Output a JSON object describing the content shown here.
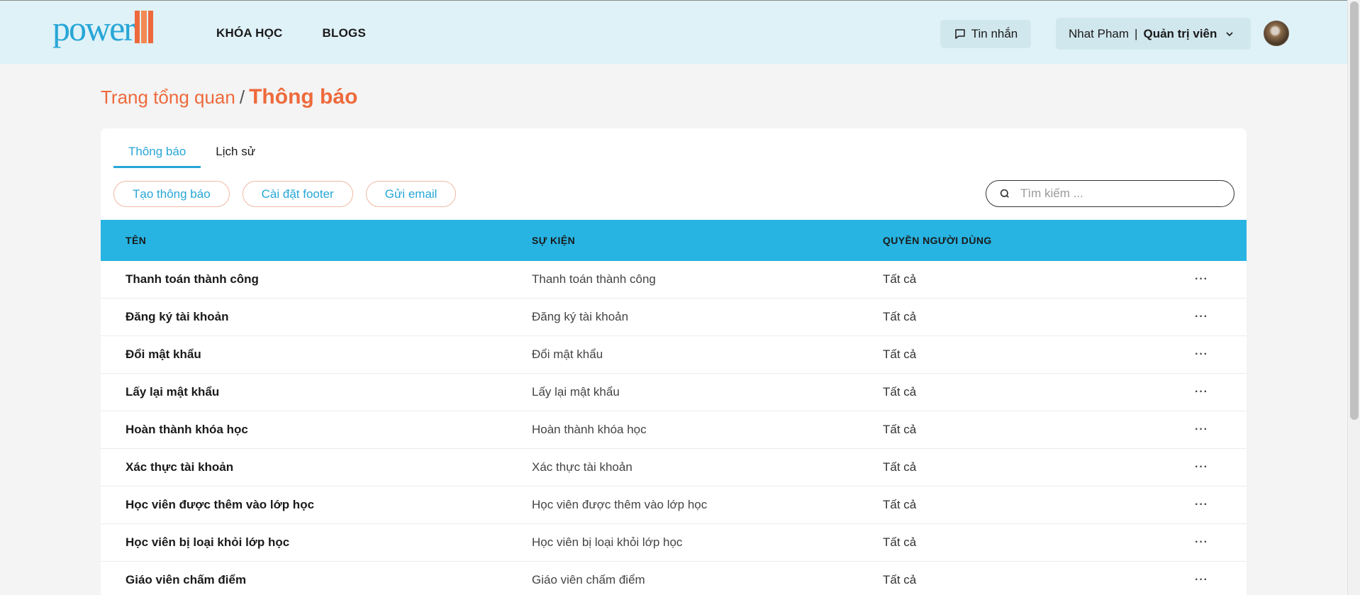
{
  "brand": {
    "logo_text": "power",
    "logo_mark_icon": "book-stack-icon"
  },
  "nav": {
    "items": [
      {
        "label": "KHÓA HỌC"
      },
      {
        "label": "BLOGS"
      }
    ]
  },
  "header": {
    "messages_label": "Tin nhắn",
    "messages_icon": "chat-bubble-icon",
    "user_name": "Nhat Pham",
    "separator": "|",
    "user_role": "Quản trị viên",
    "avatar_icon": "user-avatar"
  },
  "breadcrumb": {
    "parent": "Trang tổng quan",
    "separator": "/",
    "current": "Thông báo"
  },
  "tabs": [
    {
      "label": "Thông báo",
      "active": true
    },
    {
      "label": "Lịch sử",
      "active": false
    }
  ],
  "actions": {
    "create": "Tạo thông báo",
    "footer": "Cài đặt footer",
    "email": "Gửi email"
  },
  "search": {
    "placeholder": "Tìm kiếm ...",
    "value": ""
  },
  "table": {
    "columns": {
      "name": "TÊN",
      "event": "SỰ KIỆN",
      "role": "QUYỀN NGƯỜI DÙNG"
    },
    "more_icon": "···",
    "rows": [
      {
        "name": "Thanh toán thành công",
        "event": "Thanh toán thành công",
        "role": "Tất cả"
      },
      {
        "name": "Đăng ký tài khoản",
        "event": "Đăng ký tài khoản",
        "role": "Tất cả"
      },
      {
        "name": "Đổi mật khẩu",
        "event": "Đổi mật khẩu",
        "role": "Tất cả"
      },
      {
        "name": "Lấy lại mật khẩu",
        "event": "Lấy lại mật khẩu",
        "role": "Tất cả"
      },
      {
        "name": "Hoàn thành khóa học",
        "event": "Hoàn thành khóa học",
        "role": "Tất cả"
      },
      {
        "name": "Xác thực tài khoản",
        "event": "Xác thực tài khoản",
        "role": "Tất cả"
      },
      {
        "name": "Học viên được thêm vào lớp học",
        "event": "Học viên được thêm vào lớp học",
        "role": "Tất cả"
      },
      {
        "name": "Học viên bị loại khỏi lớp học",
        "event": "Học viên bị loại khỏi lớp học",
        "role": "Tất cả"
      },
      {
        "name": "Giáo viên chấm điểm",
        "event": "Giáo viên chấm điểm",
        "role": "Tất cả"
      }
    ]
  },
  "colors": {
    "accent": "#27a6d6",
    "header_row": "#27b4e2",
    "brand_orange": "#ee6a3c",
    "topbar": "#dff2f8"
  }
}
